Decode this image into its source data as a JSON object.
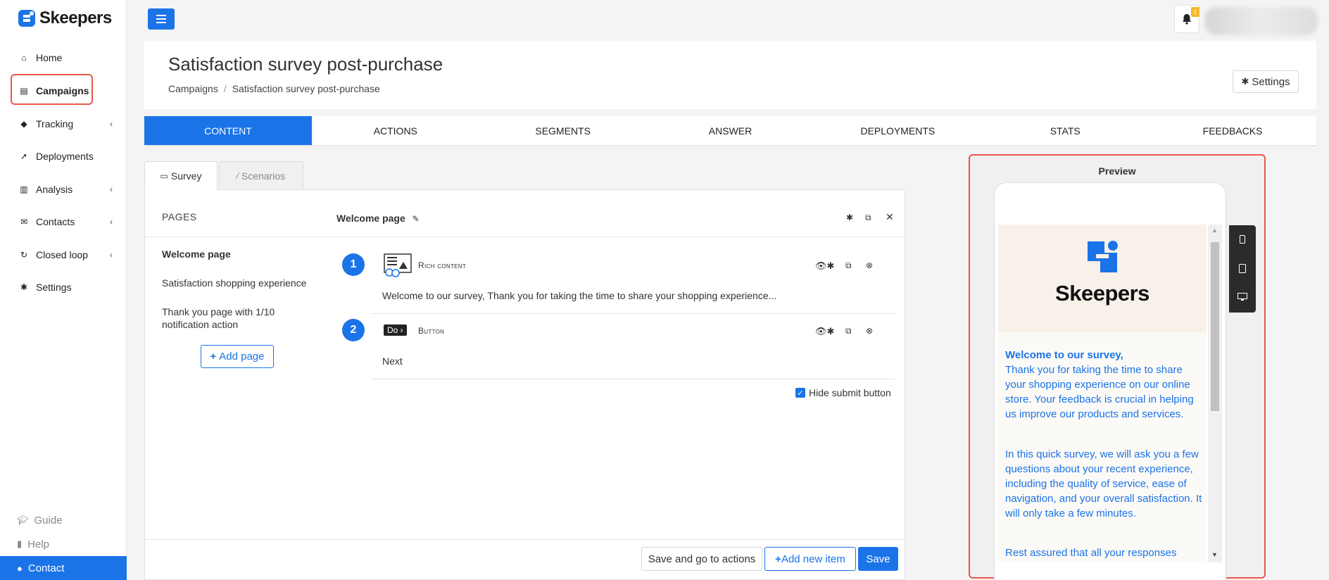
{
  "brand": {
    "name": "Skeepers",
    "accent": "#1b73e8",
    "highlight": "#e8584a"
  },
  "sidebar": {
    "items": [
      {
        "label": "Home",
        "icon": "home-icon"
      },
      {
        "label": "Campaigns",
        "icon": "file-icon"
      },
      {
        "label": "Tracking",
        "icon": "tag-icon"
      },
      {
        "label": "Deployments",
        "icon": "rocket-icon"
      },
      {
        "label": "Analysis",
        "icon": "bar-chart-icon"
      },
      {
        "label": "Contacts",
        "icon": "envelope-icon"
      },
      {
        "label": "Closed loop",
        "icon": "refresh-icon"
      },
      {
        "label": "Settings",
        "icon": "gear-icon"
      }
    ],
    "guide": "Guide",
    "help": "Help",
    "contact": "Contact"
  },
  "topbar": {
    "notification_count": "1"
  },
  "header": {
    "title": "Satisfaction survey post-purchase",
    "breadcrumb": [
      "Campaigns",
      "Satisfaction survey post-purchase"
    ],
    "settings_label": "Settings"
  },
  "tabs": [
    "CONTENT",
    "ACTIONS",
    "SEGMENTS",
    "ANSWER",
    "DEPLOYMENTS",
    "STATS",
    "FEEDBACKS"
  ],
  "subtabs": {
    "survey": "Survey",
    "scenarios": "Scenarios"
  },
  "pages": {
    "label": "PAGES",
    "items": [
      "Welcome page",
      "Satisfaction shopping experience",
      "Thank you page with 1/10 notification action"
    ],
    "add_label": "Add page"
  },
  "welcome_page": {
    "title": "Welcome page",
    "items": [
      {
        "num": "1",
        "type": "Rich content",
        "text": "Welcome to our survey, Thank you for taking the time to share your shopping experience..."
      },
      {
        "num": "2",
        "type": "Button",
        "badge": "Do",
        "text": "Next"
      }
    ],
    "hide_submit_label": "Hide submit button"
  },
  "footer": {
    "save_go_label": "Save and go to actions",
    "add_item_label": "Add new item",
    "save_label": "Save"
  },
  "preview": {
    "title": "Preview",
    "brand": "Skeepers",
    "welcome_heading": "Welcome to our survey,",
    "paragraph1": "Thank you for taking the time to share your shopping experience on our online store. Your feedback is crucial in helping us improve our products and services.",
    "paragraph2": "In this quick survey, we will ask you a few questions about your recent experience, including the quality of service, ease of navigation, and your overall satisfaction. It will only take a few minutes.",
    "paragraph3": "Rest assured that all your responses"
  }
}
